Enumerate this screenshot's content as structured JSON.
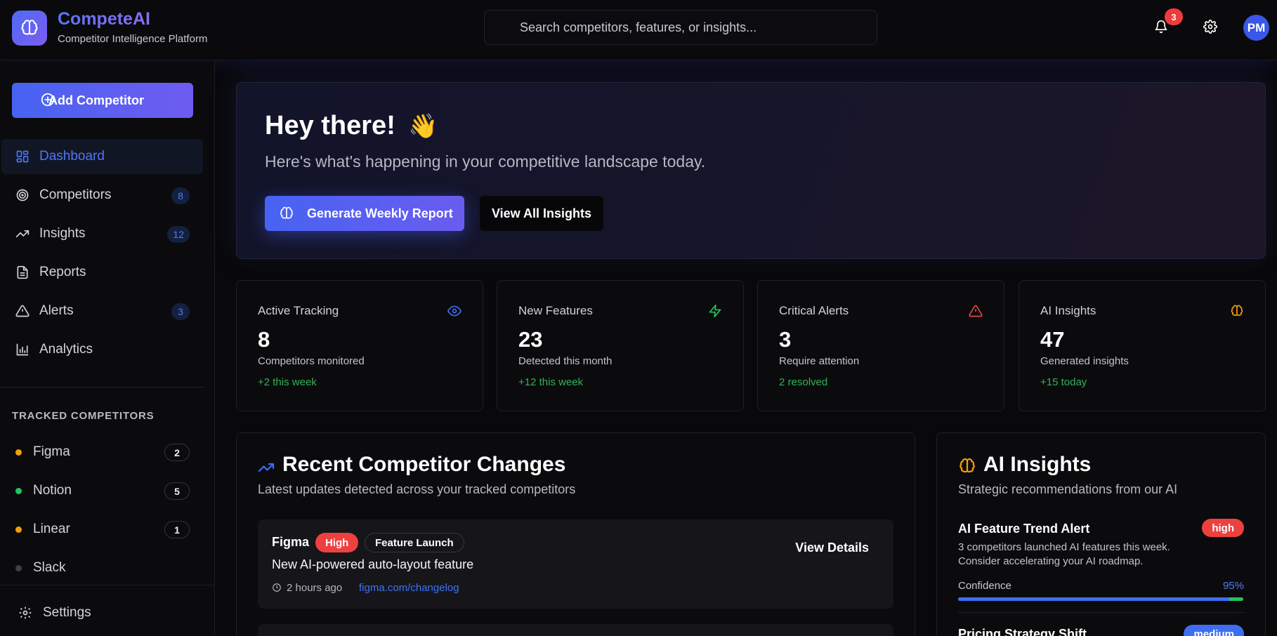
{
  "brand": {
    "name": "CompeteAI",
    "subtitle": "Competitor Intelligence Platform",
    "logo_icon": "brain-icon"
  },
  "header": {
    "search_placeholder": "Search competitors, features, or insights...",
    "notification_count": "3",
    "avatar_initials": "PM"
  },
  "sidebar": {
    "add_button": "Add Competitor",
    "nav": [
      {
        "label": "Dashboard",
        "icon": "dashboard-icon",
        "badge": ""
      },
      {
        "label": "Competitors",
        "icon": "target-icon",
        "badge": "8"
      },
      {
        "label": "Insights",
        "icon": "trending-up-icon",
        "badge": "12"
      },
      {
        "label": "Reports",
        "icon": "file-text-icon",
        "badge": ""
      },
      {
        "label": "Alerts",
        "icon": "alert-triangle-icon",
        "badge": "3"
      },
      {
        "label": "Analytics",
        "icon": "bar-chart-icon",
        "badge": ""
      }
    ],
    "section_title": "TRACKED COMPETITORS",
    "competitors": [
      {
        "name": "Figma",
        "count": "2",
        "color": "#f59e0b"
      },
      {
        "name": "Notion",
        "count": "5",
        "color": "#22c55e"
      },
      {
        "name": "Linear",
        "count": "1",
        "color": "#f59e0b"
      },
      {
        "name": "Slack",
        "count": "",
        "color": "#3f3f46"
      }
    ],
    "settings": "Settings"
  },
  "hero": {
    "title": "Hey there!",
    "emoji": "👋",
    "subtitle": "Here's what's happening in your competitive landscape today.",
    "primary_button": "Generate Weekly Report",
    "secondary_button": "View All Insights"
  },
  "stats": [
    {
      "label": "Active Tracking",
      "value": "8",
      "desc": "Competitors monitored",
      "delta": "+2 this week",
      "icon": "eye-icon",
      "icon_color": "#3d6ef2"
    },
    {
      "label": "New Features",
      "value": "23",
      "desc": "Detected this month",
      "delta": "+12 this week",
      "icon": "zap-icon",
      "icon_color": "#22c55e"
    },
    {
      "label": "Critical Alerts",
      "value": "3",
      "desc": "Require attention",
      "delta": "2 resolved",
      "icon": "alert-triangle-icon",
      "icon_color": "#ef4444"
    },
    {
      "label": "AI Insights",
      "value": "47",
      "desc": "Generated insights",
      "delta": "+15 today",
      "icon": "brain-icon",
      "icon_color": "#f59e0b"
    }
  ],
  "changes": {
    "title": "Recent Competitor Changes",
    "subtitle": "Latest updates detected across your tracked competitors",
    "items": [
      {
        "competitor": "Figma",
        "priority": "High",
        "type": "Feature Launch",
        "title": "New AI-powered auto-layout feature",
        "time": "2 hours ago",
        "link": "figma.com/changelog",
        "action": "View Details"
      }
    ]
  },
  "insights": {
    "title": "AI Insights",
    "subtitle": "Strategic recommendations from our AI",
    "items": [
      {
        "title": "AI Feature Trend Alert",
        "level": "high",
        "desc": "3 competitors launched AI features this week. Consider accelerating your AI roadmap.",
        "confidence_label": "Confidence",
        "confidence": "95%",
        "confidence_value": 0.95
      },
      {
        "title": "Pricing Strategy Shift",
        "level": "medium"
      }
    ]
  }
}
